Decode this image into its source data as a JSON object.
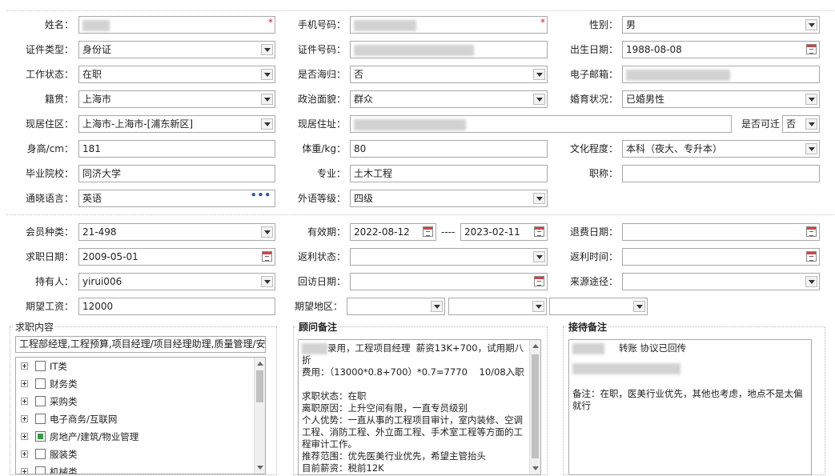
{
  "basic": {
    "name_label": "姓名：",
    "mobile_label": "手机号码：",
    "gender_label": "性别：",
    "gender": "男",
    "id_type_label": "证件类型：",
    "id_type": "身份证",
    "id_no_label": "证件号码：",
    "birth_label": "出生日期：",
    "birth": "1988-08-08",
    "work_status_label": "工作状态：",
    "work_status": "在职",
    "overseas_label": "是否海归：",
    "overseas": "否",
    "email_label": "电子邮箱：",
    "native_label": "籍贯：",
    "native": "上海市",
    "politics_label": "政治面貌：",
    "politics": "群众",
    "marital_label": "婚育状况：",
    "marital": "已婚男性",
    "region_label": "现居住区：",
    "region": "上海市-上海市-[浦东新区]",
    "address_label": "现居住址：",
    "movable_label": "是否可迁",
    "movable": "否",
    "height_label": "身高/cm：",
    "height": "181",
    "weight_label": "体重/kg：",
    "weight": "80",
    "education_label": "文化程度：",
    "education": "本科（夜大、专升本）",
    "school_label": "毕业院校：",
    "school": "同济大学",
    "major_label": "专业：",
    "major": "土木工程",
    "title_label": "职称：",
    "title": "",
    "language_label": "通晓语言：",
    "language": "英语",
    "lang_level_label": "外语等级：",
    "lang_level": "四级",
    "required_mark": "*",
    "more_dots": "•••"
  },
  "member": {
    "type_label": "会员种类：",
    "type": "21-498",
    "valid_label": "有效期：",
    "valid_from": "2022-08-12",
    "valid_sep": "----",
    "valid_to": "2023-02-11",
    "refund_date_label": "退费日期：",
    "refund_date": "",
    "job_date_label": "求职日期：",
    "job_date": "2009-05-01",
    "rebate_status_label": "返利状态：",
    "rebate_status": "",
    "rebate_time_label": "返利时间：",
    "rebate_time": "",
    "holder_label": "持有人：",
    "holder": "yirui006",
    "visit_date_label": "回访日期：",
    "visit_date": "",
    "source_label": "来源途径：",
    "source": "",
    "salary_label": "期望工资：",
    "salary": "12000",
    "area_label": "期望地区："
  },
  "job_intent": {
    "title": "求职内容",
    "summary": "工程部经理,工程预算,项目经理/项目经理助理,质量管理/安",
    "categories": [
      {
        "label": "IT类",
        "checked": false
      },
      {
        "label": "财务类",
        "checked": false
      },
      {
        "label": "采购类",
        "checked": false
      },
      {
        "label": "电子商务/互联网",
        "checked": false
      },
      {
        "label": "房地产/建筑/物业管理",
        "checked": true
      },
      {
        "label": "服装类",
        "checked": false
      },
      {
        "label": "机械类",
        "checked": false
      }
    ]
  },
  "advisor_note": {
    "title": "顾问备注",
    "lines": [
      "录用，工程项目经理  薪资13K+700，试用期八折",
      "费用：（13000*0.8+700）*0.7=7770    10/08入职",
      "",
      "求职状态：在职",
      "离职原因：上升空间有限，一直专员级别",
      "个人优势：一直从事的工程项目审计，室内装修、空调工程、消防工程、外立面工程、手术室工程等方面的工程审计工作。",
      "推荐范围：优先医美行业优先，希望主管抬头",
      "目前薪资：税前12K"
    ]
  },
  "reception_note": {
    "title": "接待备注",
    "line1": "转账 协议已回传",
    "line3": "备注：在职，医美行业优先，其他也考虑，地点不是太偏就行"
  }
}
